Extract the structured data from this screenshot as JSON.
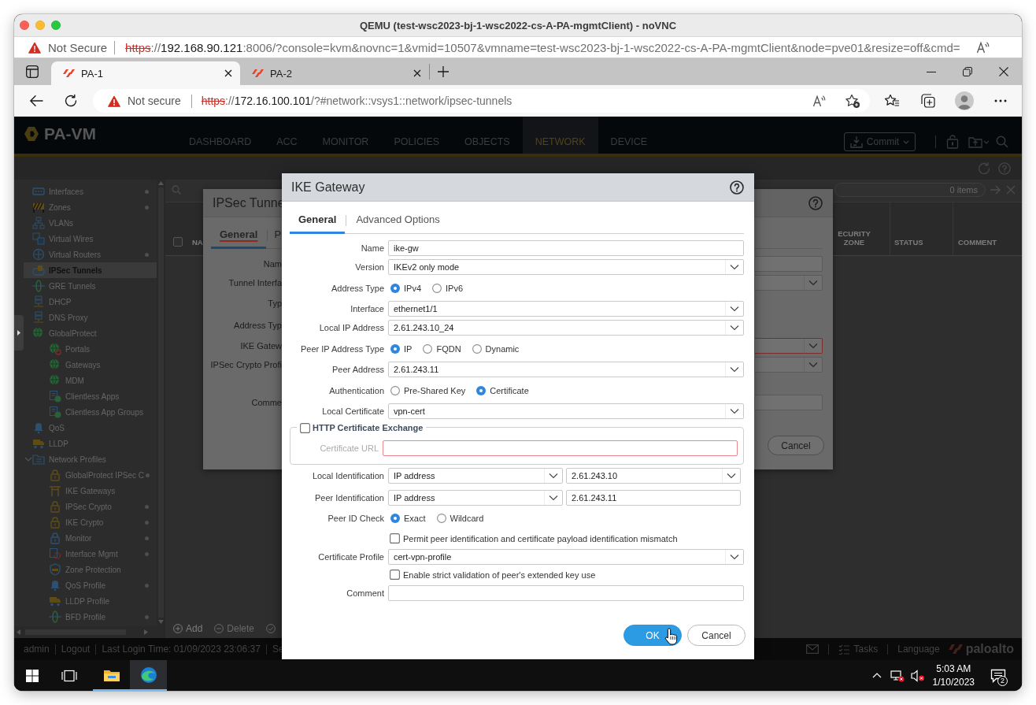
{
  "mac_window": {
    "title": "QEMU (test-wsc2023-bj-1-wsc2022-cs-A-PA-mgmtClient) - noVNC",
    "security": "Not Secure",
    "url": [
      {
        "kind": "scheme",
        "text": "https"
      },
      {
        "kind": "plain",
        "text": "://"
      },
      {
        "kind": "host",
        "text": "192.168.90.121"
      },
      {
        "kind": "plain",
        "text": ":8006/?console=kvm&novnc=1&vmid=10507&vmname=test-wsc2023-bj-1-wsc2022-cs-A-PA-mgmtClient&node=pve01&resize=off&cmd="
      }
    ]
  },
  "browser": {
    "tabs": [
      {
        "title": "PA-1",
        "selected": true
      },
      {
        "title": "PA-2",
        "selected": false
      }
    ],
    "security": "Not secure",
    "url": [
      {
        "kind": "scheme",
        "text": "https"
      },
      {
        "kind": "plain",
        "text": "://"
      },
      {
        "kind": "host",
        "text": "172.16.100.101"
      },
      {
        "kind": "plain",
        "text": "/?#network::vsys1::network/ipsec-tunnels"
      }
    ]
  },
  "app": {
    "logo": "PA-VM",
    "nav": [
      {
        "label": "DASHBOARD",
        "selected": false
      },
      {
        "label": "ACC",
        "selected": false
      },
      {
        "label": "MONITOR",
        "selected": false
      },
      {
        "label": "POLICIES",
        "selected": false
      },
      {
        "label": "OBJECTS",
        "selected": false
      },
      {
        "label": "NETWORK",
        "selected": true
      },
      {
        "label": "DEVICE",
        "selected": false
      }
    ],
    "commit": "Commit",
    "sidebar": [
      {
        "label": "Interfaces",
        "selected": false,
        "marked": true
      },
      {
        "label": "Zones",
        "selected": false,
        "marked": true
      },
      {
        "label": "VLANs",
        "selected": false,
        "marked": false
      },
      {
        "label": "Virtual Wires",
        "selected": false,
        "marked": false
      },
      {
        "label": "Virtual Routers",
        "selected": false,
        "marked": true
      },
      {
        "label": "IPSec Tunnels",
        "selected": true,
        "marked": false
      },
      {
        "label": "GRE Tunnels",
        "selected": false,
        "marked": false
      },
      {
        "label": "DHCP",
        "selected": false,
        "marked": false
      },
      {
        "label": "DNS Proxy",
        "selected": false,
        "marked": false
      },
      {
        "label": "GlobalProtect",
        "selected": false,
        "marked": false,
        "children": [
          {
            "label": "Portals",
            "selected": false,
            "marked": false
          },
          {
            "label": "Gateways",
            "selected": false,
            "marked": false
          },
          {
            "label": "MDM",
            "selected": false,
            "marked": false
          },
          {
            "label": "Clientless Apps",
            "selected": false,
            "marked": false
          },
          {
            "label": "Clientless App Groups",
            "selected": false,
            "marked": false
          }
        ]
      },
      {
        "label": "QoS",
        "selected": false,
        "marked": false
      },
      {
        "label": "LLDP",
        "selected": false,
        "marked": false
      },
      {
        "label": "Network Profiles",
        "selected": false,
        "marked": false,
        "expanded": true,
        "children": [
          {
            "label": "GlobalProtect IPSec C",
            "selected": false,
            "marked": true
          },
          {
            "label": "IKE Gateways",
            "selected": false,
            "marked": false
          },
          {
            "label": "IPSec Crypto",
            "selected": false,
            "marked": true
          },
          {
            "label": "IKE Crypto",
            "selected": false,
            "marked": true
          },
          {
            "label": "Monitor",
            "selected": false,
            "marked": true
          },
          {
            "label": "Interface Mgmt",
            "selected": false,
            "marked": true
          },
          {
            "label": "Zone Protection",
            "selected": false,
            "marked": false
          },
          {
            "label": "QoS Profile",
            "selected": false,
            "marked": true
          },
          {
            "label": "LLDP Profile",
            "selected": false,
            "marked": false
          },
          {
            "label": "BFD Profile",
            "selected": false,
            "marked": true
          }
        ]
      }
    ],
    "table": {
      "count": "0 items",
      "all_checked": false,
      "columns": [
        "NA",
        "ECURITY ZONE",
        "STATUS",
        "COMMENT"
      ],
      "actions": [
        {
          "label": "Add",
          "disabled": false
        },
        {
          "label": "Delete",
          "disabled": true
        },
        {
          "disabled": true
        }
      ]
    },
    "status_bar": {
      "items": [
        "admin",
        "Logout",
        "Last Login Time: 01/09/2023 23:06:37",
        "Se"
      ],
      "tasks": "Tasks",
      "language": "Language",
      "logo": "paloalto"
    }
  },
  "ipsec_dialog": {
    "title": "IPSec Tunne",
    "tabs": [
      {
        "label": "General",
        "selected": true,
        "error": true
      },
      {
        "label": "P",
        "selected": false,
        "error": false
      }
    ],
    "rows": [
      {
        "kind": "input",
        "label": "Nam",
        "invalid": false
      },
      {
        "kind": "select",
        "label": "Tunnel Interfa",
        "invalid": false
      },
      {
        "kind": "plain",
        "label": "Typ"
      },
      {
        "kind": "plain",
        "label": "Address Typ"
      },
      {
        "kind": "select",
        "label": "IKE Gatew",
        "invalid": true
      },
      {
        "kind": "select",
        "label": "IPSec Crypto Profi",
        "invalid": false
      },
      {
        "kind": "input",
        "label": "Comme",
        "invalid": false
      }
    ],
    "buttons": [
      {
        "kind": "secondary",
        "label": "Cancel"
      }
    ]
  },
  "ike_dialog": {
    "title": "IKE Gateway",
    "tabs": [
      {
        "label": "General",
        "selected": true
      },
      {
        "label": "Advanced Options",
        "selected": false
      }
    ],
    "rows": [
      {
        "kind": "input",
        "label": "Name",
        "value": "ike-gw"
      },
      {
        "kind": "select",
        "label": "Version",
        "value": "IKEv2 only mode"
      },
      {
        "kind": "radio",
        "label": "Address Type",
        "options": [
          {
            "label": "IPv4",
            "selected": true
          },
          {
            "label": "IPv6",
            "selected": false
          }
        ]
      },
      {
        "kind": "select",
        "label": "Interface",
        "value": "ethernet1/1"
      },
      {
        "kind": "select",
        "label": "Local IP Address",
        "value": "2.61.243.10_24"
      },
      {
        "kind": "radio",
        "label": "Peer IP Address Type",
        "options": [
          {
            "label": "IP",
            "selected": true
          },
          {
            "label": "FQDN",
            "selected": false
          },
          {
            "label": "Dynamic",
            "selected": false
          }
        ]
      },
      {
        "kind": "select",
        "label": "Peer Address",
        "value": "2.61.243.11"
      },
      {
        "kind": "radio",
        "label": "Authentication",
        "options": [
          {
            "label": "Pre-Shared Key",
            "selected": false
          },
          {
            "label": "Certificate",
            "selected": true
          }
        ]
      },
      {
        "kind": "select",
        "label": "Local Certificate",
        "value": "vpn-cert"
      },
      {
        "kind": "group",
        "legend": "HTTP Certificate Exchange",
        "checked": false,
        "rows": [
          {
            "kind": "input",
            "label": "Certificate URL",
            "disabled": true,
            "invalid": true
          }
        ]
      },
      {
        "kind": "pair",
        "label": "Local Identification",
        "fields": [
          {
            "kind": "select",
            "value": "IP address"
          },
          {
            "kind": "select",
            "value": "2.61.243.10"
          }
        ]
      },
      {
        "kind": "pair",
        "label": "Peer Identification",
        "fields": [
          {
            "kind": "select",
            "value": "IP address"
          },
          {
            "kind": "input",
            "value": "2.61.243.11"
          }
        ]
      },
      {
        "kind": "radio",
        "label": "Peer ID Check",
        "options": [
          {
            "label": "Exact",
            "selected": true
          },
          {
            "label": "Wildcard",
            "selected": false
          }
        ]
      },
      {
        "kind": "check",
        "label": "Permit peer identification and certificate payload identification mismatch",
        "checked": false
      },
      {
        "kind": "select",
        "label": "Certificate Profile",
        "value": "cert-vpn-profile"
      },
      {
        "kind": "check",
        "label": "Enable strict validation of peer's extended key use",
        "checked": false
      },
      {
        "kind": "input",
        "label": "Comment"
      }
    ],
    "buttons": [
      {
        "kind": "primary",
        "label": "OK"
      },
      {
        "kind": "secondary",
        "label": "Cancel"
      }
    ]
  },
  "taskbar": {
    "apps": [
      {
        "kind": "explorer",
        "selected": false
      },
      {
        "kind": "browser",
        "selected": true
      }
    ],
    "time": "5:03 AM",
    "date": "1/10/2023",
    "notifications": "2"
  }
}
